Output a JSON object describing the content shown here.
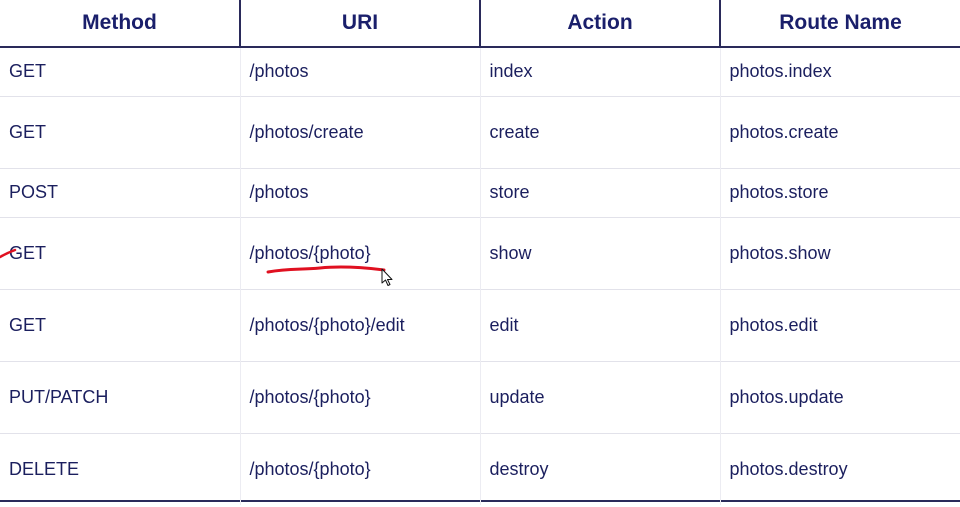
{
  "table": {
    "headers": [
      "Method",
      "URI",
      "Action",
      "Route Name"
    ],
    "rows": [
      [
        "GET",
        "/photos",
        "index",
        "photos.index"
      ],
      [
        "GET",
        "/photos/create",
        "create",
        "photos.create"
      ],
      [
        "POST",
        "/photos",
        "store",
        "photos.store"
      ],
      [
        "GET",
        "/photos/{photo}",
        "show",
        "photos.show"
      ],
      [
        "GET",
        "/photos/{photo}/edit",
        "edit",
        "photos.edit"
      ],
      [
        "PUT/PATCH",
        "/photos/{photo}",
        "update",
        "photos.update"
      ],
      [
        "DELETE",
        "/photos/{photo}",
        "destroy",
        "photos.destroy"
      ]
    ]
  },
  "colors": {
    "header_text": "#1a1f6b",
    "cell_text": "#1b1f5e",
    "rule": "#2a2a5a",
    "annotation": "#e01020"
  },
  "annotations": {
    "underline_target": "/photos/{photo}",
    "cursor": "arrow-cursor-icon"
  }
}
